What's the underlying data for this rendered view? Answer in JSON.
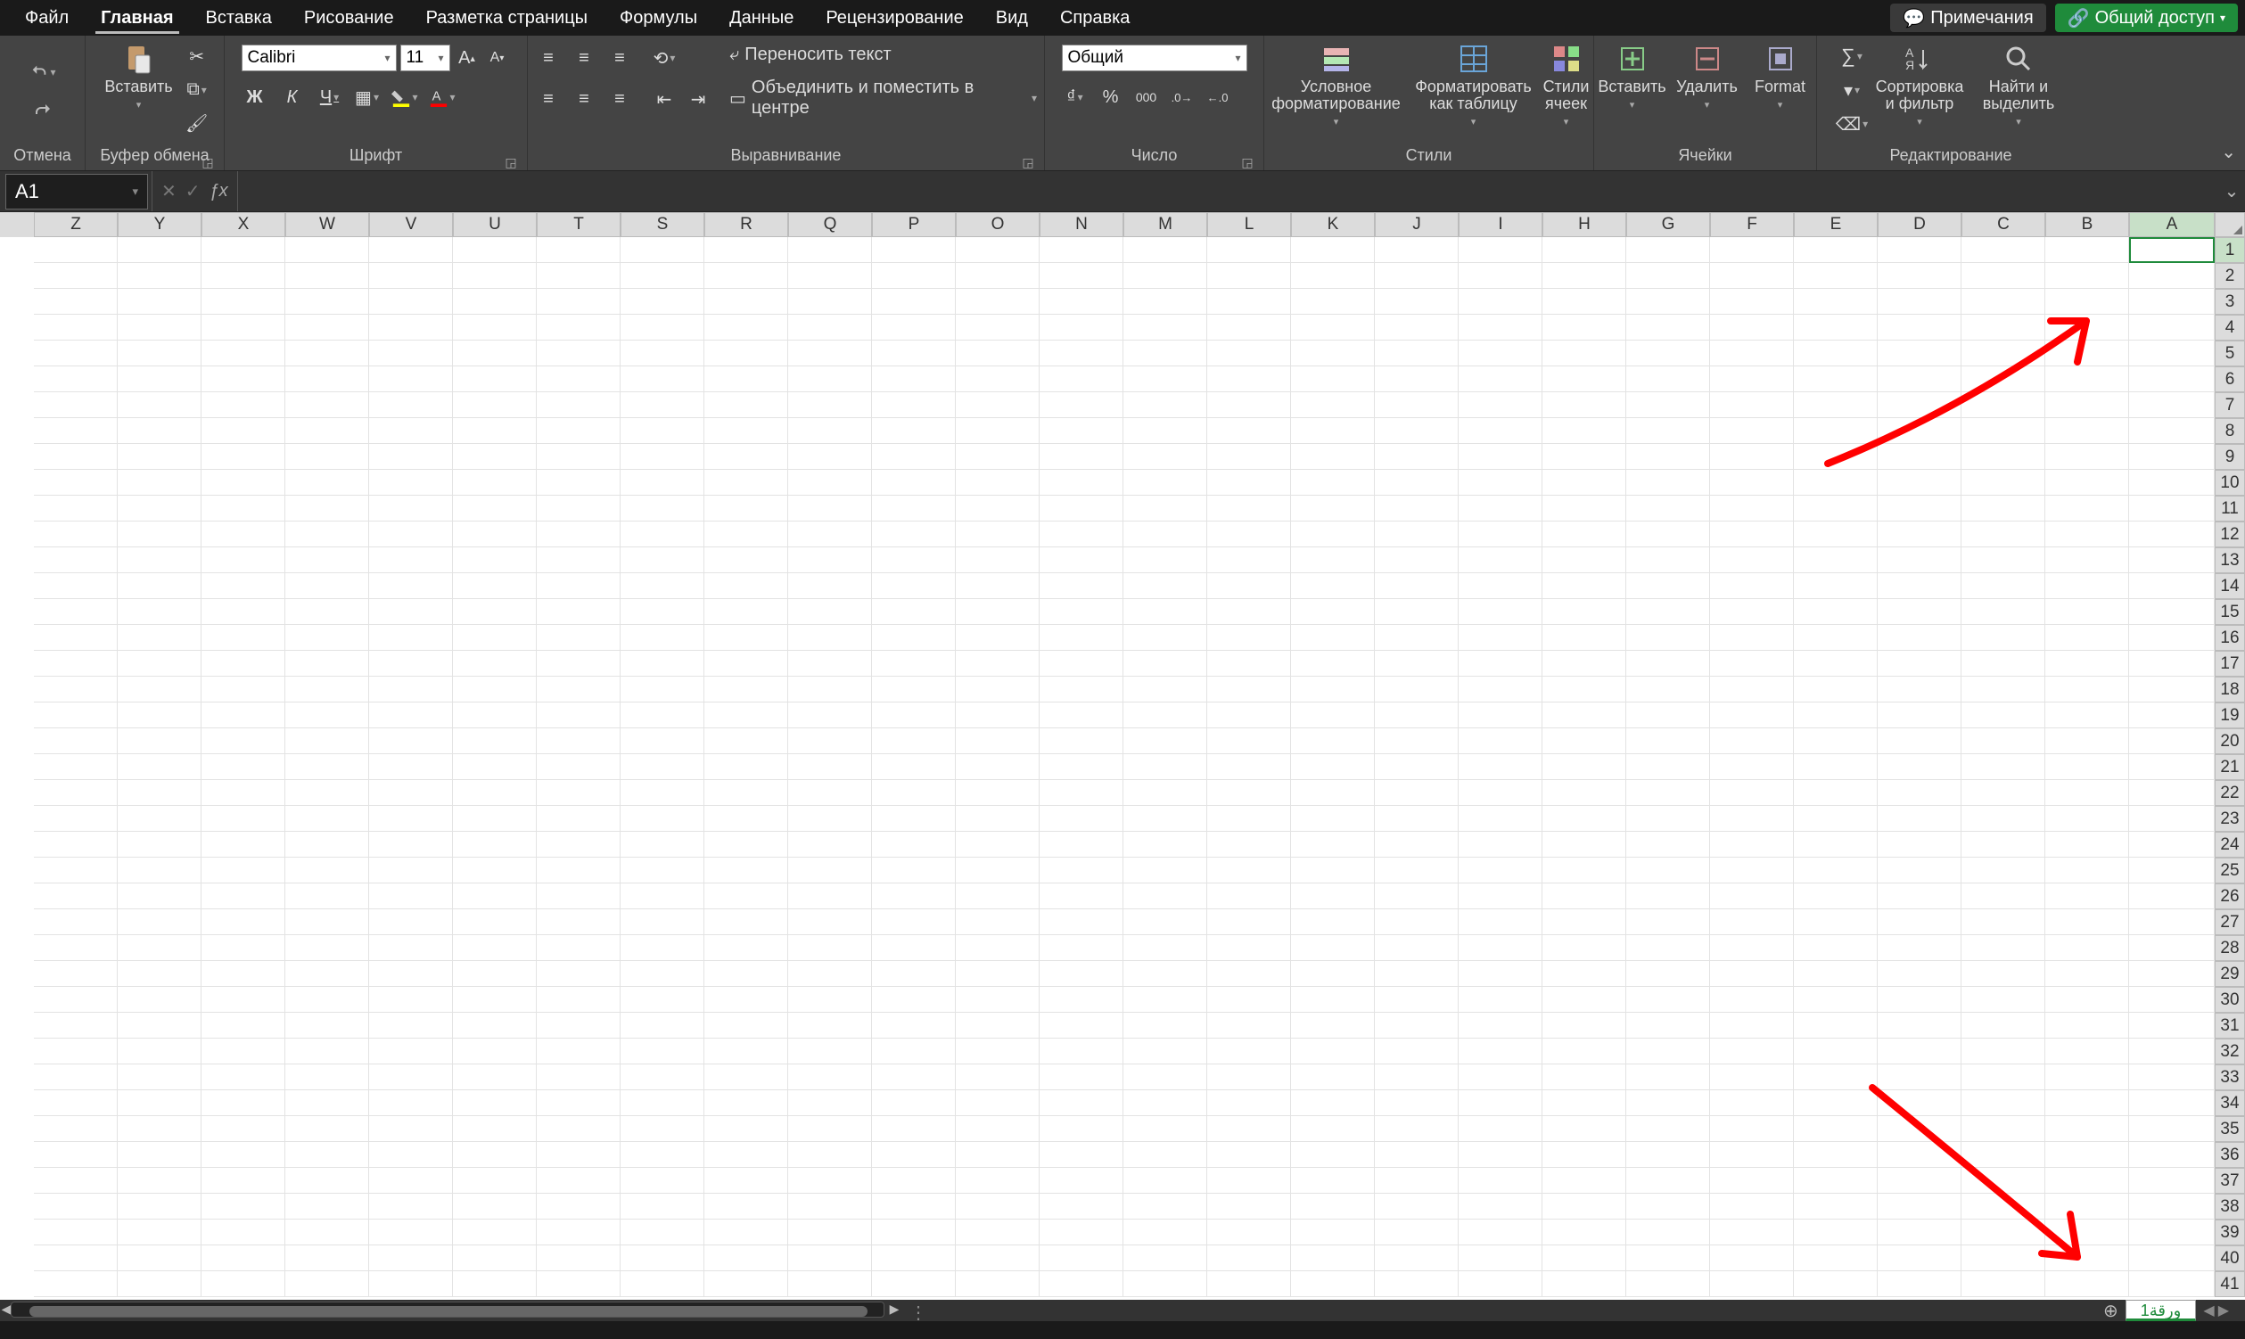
{
  "tabs": {
    "file": "Файл",
    "home": "Главная",
    "insert": "Вставка",
    "draw": "Рисование",
    "layout": "Разметка страницы",
    "formulas": "Формулы",
    "data": "Данные",
    "review": "Рецензирование",
    "view": "Вид",
    "help": "Справка"
  },
  "header_buttons": {
    "comments": "Примечания",
    "share": "Общий доступ"
  },
  "ribbon": {
    "undo_group": "Отмена",
    "clipboard_group": "Буфер обмена",
    "paste": "Вставить",
    "font_group": "Шрифт",
    "font_name": "Calibri",
    "font_size": "11",
    "alignment_group": "Выравнивание",
    "wrap_text": "Переносить текст",
    "merge_center": "Объединить и поместить в центре",
    "number_group": "Число",
    "number_format": "Общий",
    "styles_group": "Стили",
    "cond_format": "Условное форматирование",
    "format_table": "Форматировать как таблицу",
    "cell_styles": "Стили ячеек",
    "cells_group": "Ячейки",
    "insert_btn": "Вставить",
    "delete_btn": "Удалить",
    "format_btn": "Format",
    "editing_group": "Редактирование",
    "sort_filter": "Сортировка и фильтр",
    "find_select": "Найти и выделить"
  },
  "formula_bar": {
    "name_box": "A1",
    "formula": ""
  },
  "grid": {
    "columns": [
      "A",
      "B",
      "C",
      "D",
      "E",
      "F",
      "G",
      "H",
      "I",
      "J",
      "K",
      "L",
      "M",
      "N",
      "O",
      "P",
      "Q",
      "R",
      "S",
      "T",
      "U",
      "V",
      "W",
      "X",
      "Y",
      "Z"
    ],
    "rows": 41,
    "active_cell": "A1"
  },
  "sheet": {
    "active_tab": "ورقة1"
  }
}
